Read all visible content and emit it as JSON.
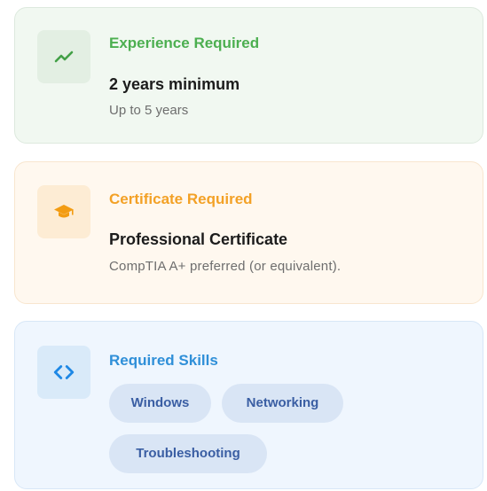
{
  "experience": {
    "icon": "trending-up-icon",
    "accent_color": "#4caf50",
    "title": "Experience Required",
    "main": "2 years minimum",
    "sub": "Up to 5 years"
  },
  "certificate": {
    "icon": "graduation-cap-icon",
    "accent_color": "#f3a126",
    "title": "Certificate Required",
    "main": "Professional Certificate",
    "sub": "CompTIA A+ preferred (or equivalent)."
  },
  "skills": {
    "icon": "code-icon",
    "accent_color": "#2f8fd8",
    "title": "Required Skills",
    "items": [
      "Windows",
      "Networking",
      "Troubleshooting"
    ]
  }
}
